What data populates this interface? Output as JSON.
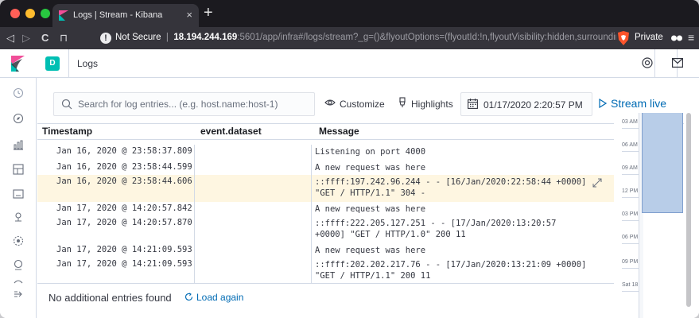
{
  "browser": {
    "tab_title": "Logs | Stream - Kibana",
    "tab_close": "×",
    "new_tab": "+",
    "back": "◁",
    "forward": "▷",
    "reload": "C",
    "bookmark": "⊓",
    "warning_glyph": "!",
    "security_label": "Not Secure",
    "url_host": "18.194.244.169",
    "url_rest": ":5601/app/infra#/logs/stream?_g=()&flyoutOptions=(flyoutId:!n,flyoutVisibility:hidden,surroundin...",
    "private_label": "Private",
    "menu_glyph": "≡"
  },
  "header": {
    "space_initial": "D",
    "app_title": "Logs"
  },
  "toolbar": {
    "search_placeholder": "Search for log entries... (e.g. host.name:host-1)",
    "customize_label": "Customize",
    "highlights_label": "Highlights",
    "date_value": "01/17/2020 2:20:57 PM",
    "stream_live_label": "Stream live"
  },
  "table": {
    "headers": {
      "timestamp": "Timestamp",
      "dataset": "event.dataset",
      "message": "Message"
    },
    "rows": [
      {
        "timestamp": "Jan 16, 2020 @ 23:58:37.809",
        "dataset": "",
        "message": "Listening on port 4000"
      },
      {
        "timestamp": "Jan 16, 2020 @ 23:58:44.599",
        "dataset": "",
        "message": "A new request was here"
      },
      {
        "timestamp": "Jan 16, 2020 @ 23:58:44.606",
        "dataset": "",
        "message": "::ffff:197.242.96.244 - - [16/Jan/2020:22:58:44 +0000] \"GET / HTTP/1.1\" 304 -"
      },
      {
        "timestamp": "Jan 17, 2020 @ 14:20:57.842",
        "dataset": "",
        "message": "A new request was here"
      },
      {
        "timestamp": "Jan 17, 2020 @ 14:20:57.870",
        "dataset": "",
        "message": "::ffff:222.205.127.251 - - [17/Jan/2020:13:20:57 +0000] \"GET / HTTP/1.0\" 200 11"
      },
      {
        "timestamp": "Jan 17, 2020 @ 14:21:09.593",
        "dataset": "",
        "message": "A new request was here"
      },
      {
        "timestamp": "Jan 17, 2020 @ 14:21:09.593",
        "dataset": "",
        "message": "::ffff:202.202.217.76 - - [17/Jan/2020:13:21:09 +0000] \"GET / HTTP/1.1\" 200 11"
      }
    ]
  },
  "footer": {
    "no_more_text": "No additional entries found",
    "load_again_label": "Load again"
  },
  "minimap": {
    "ticks": [
      "03 AM",
      "06 AM",
      "09 AM",
      "12 PM",
      "03 PM",
      "06 PM",
      "09 PM",
      "Sat 18"
    ]
  },
  "colors": {
    "accent": "#006bb4",
    "highlight_row": "#fef6e1",
    "space_badge": "#00bfb3"
  }
}
